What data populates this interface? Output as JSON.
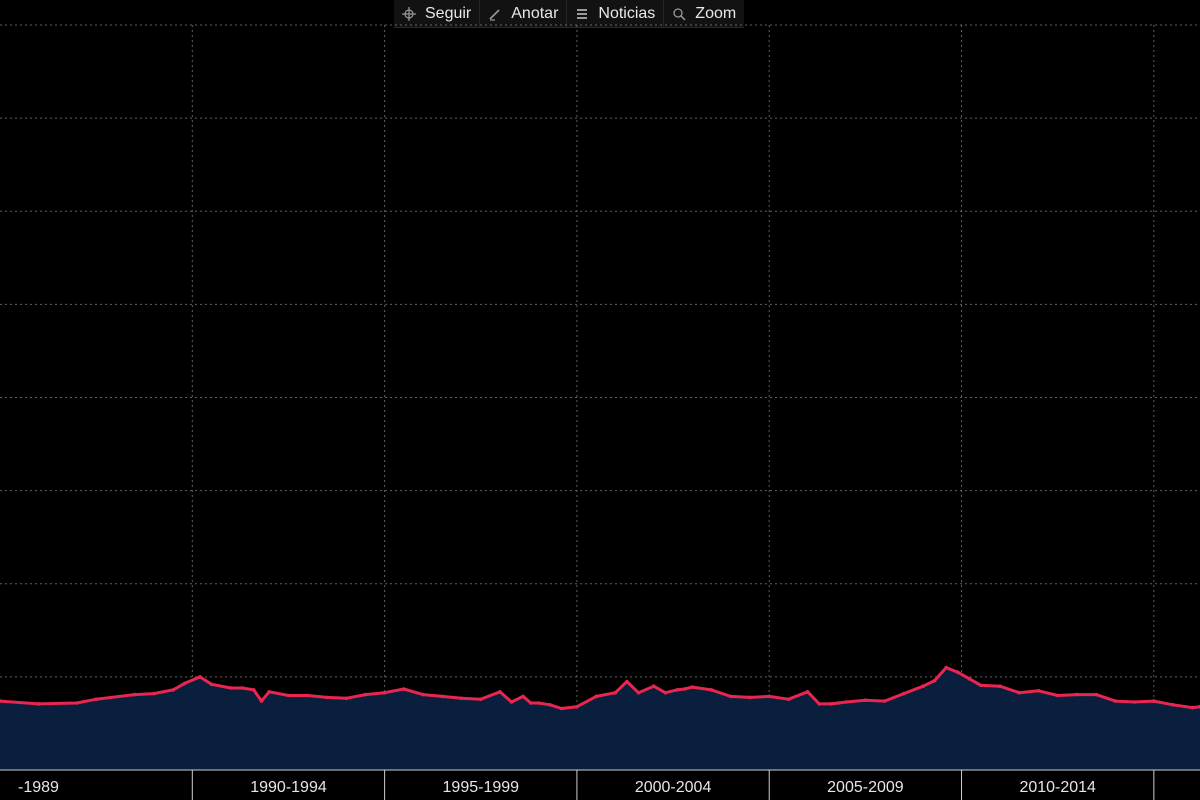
{
  "toolbar": {
    "buttons": [
      {
        "label": "Seguir",
        "icon": "crosshair-icon"
      },
      {
        "label": "Anotar",
        "icon": "pencil-icon"
      },
      {
        "label": "Noticias",
        "icon": "news-icon"
      },
      {
        "label": "Zoom",
        "icon": "magnifier-icon"
      }
    ]
  },
  "colors": {
    "background": "#000000",
    "line": "#e8264f",
    "area_fill": "#0a1f3d",
    "grid": "#7a7a7a",
    "tick_text": "#e6e6e6"
  },
  "chart_data": {
    "type": "area",
    "title": "",
    "xlabel": "",
    "ylabel": "",
    "x_ticks": [
      "-1989",
      "1990-1994",
      "1995-1999",
      "2000-2004",
      "2005-2009",
      "2010-2014"
    ],
    "xlim": [
      1985.0,
      2016.2
    ],
    "ylim": [
      0,
      8
    ],
    "grid": true,
    "legend": "none",
    "series": [
      {
        "x": [
          1985.0,
          1986.0,
          1987.0,
          1987.5,
          1988.5,
          1989.0,
          1989.5,
          1989.8,
          1990.2,
          1990.5,
          1991.0,
          1991.3,
          1991.6,
          1991.8,
          1992.0,
          1992.5,
          1993.0,
          1993.5,
          1994.0,
          1994.5,
          1995.0,
          1995.5,
          1996.0,
          1996.5,
          1997.0,
          1997.5,
          1998.0,
          1998.3,
          1998.6,
          1998.8,
          1999.0,
          1999.3,
          1999.6,
          2000.0,
          2000.5,
          2001.0,
          2001.3,
          2001.6,
          2002.0,
          2002.3,
          2002.6,
          2002.8,
          2003.0,
          2003.5,
          2004.0,
          2004.5,
          2005.0,
          2005.5,
          2006.0,
          2006.3,
          2006.6,
          2006.8,
          2007.0,
          2007.5,
          2008.0,
          2008.5,
          2009.0,
          2009.3,
          2009.6,
          2009.9,
          2010.2,
          2010.5,
          2011.0,
          2011.5,
          2012.0,
          2012.5,
          2013.0,
          2013.5,
          2014.0,
          2014.5,
          2015.0,
          2015.5,
          2016.0,
          2016.2
        ],
        "y": [
          0.74,
          0.71,
          0.72,
          0.76,
          0.81,
          0.82,
          0.86,
          0.93,
          1.0,
          0.92,
          0.88,
          0.88,
          0.86,
          0.74,
          0.84,
          0.8,
          0.8,
          0.78,
          0.77,
          0.81,
          0.83,
          0.87,
          0.81,
          0.79,
          0.77,
          0.76,
          0.84,
          0.73,
          0.79,
          0.72,
          0.72,
          0.7,
          0.66,
          0.68,
          0.79,
          0.83,
          0.95,
          0.83,
          0.9,
          0.83,
          0.86,
          0.87,
          0.89,
          0.86,
          0.79,
          0.78,
          0.79,
          0.76,
          0.84,
          0.71,
          0.71,
          0.72,
          0.73,
          0.75,
          0.74,
          0.82,
          0.9,
          0.96,
          1.1,
          1.05,
          0.98,
          0.91,
          0.9,
          0.83,
          0.85,
          0.8,
          0.81,
          0.81,
          0.74,
          0.73,
          0.74,
          0.7,
          0.67,
          0.68
        ]
      }
    ]
  }
}
